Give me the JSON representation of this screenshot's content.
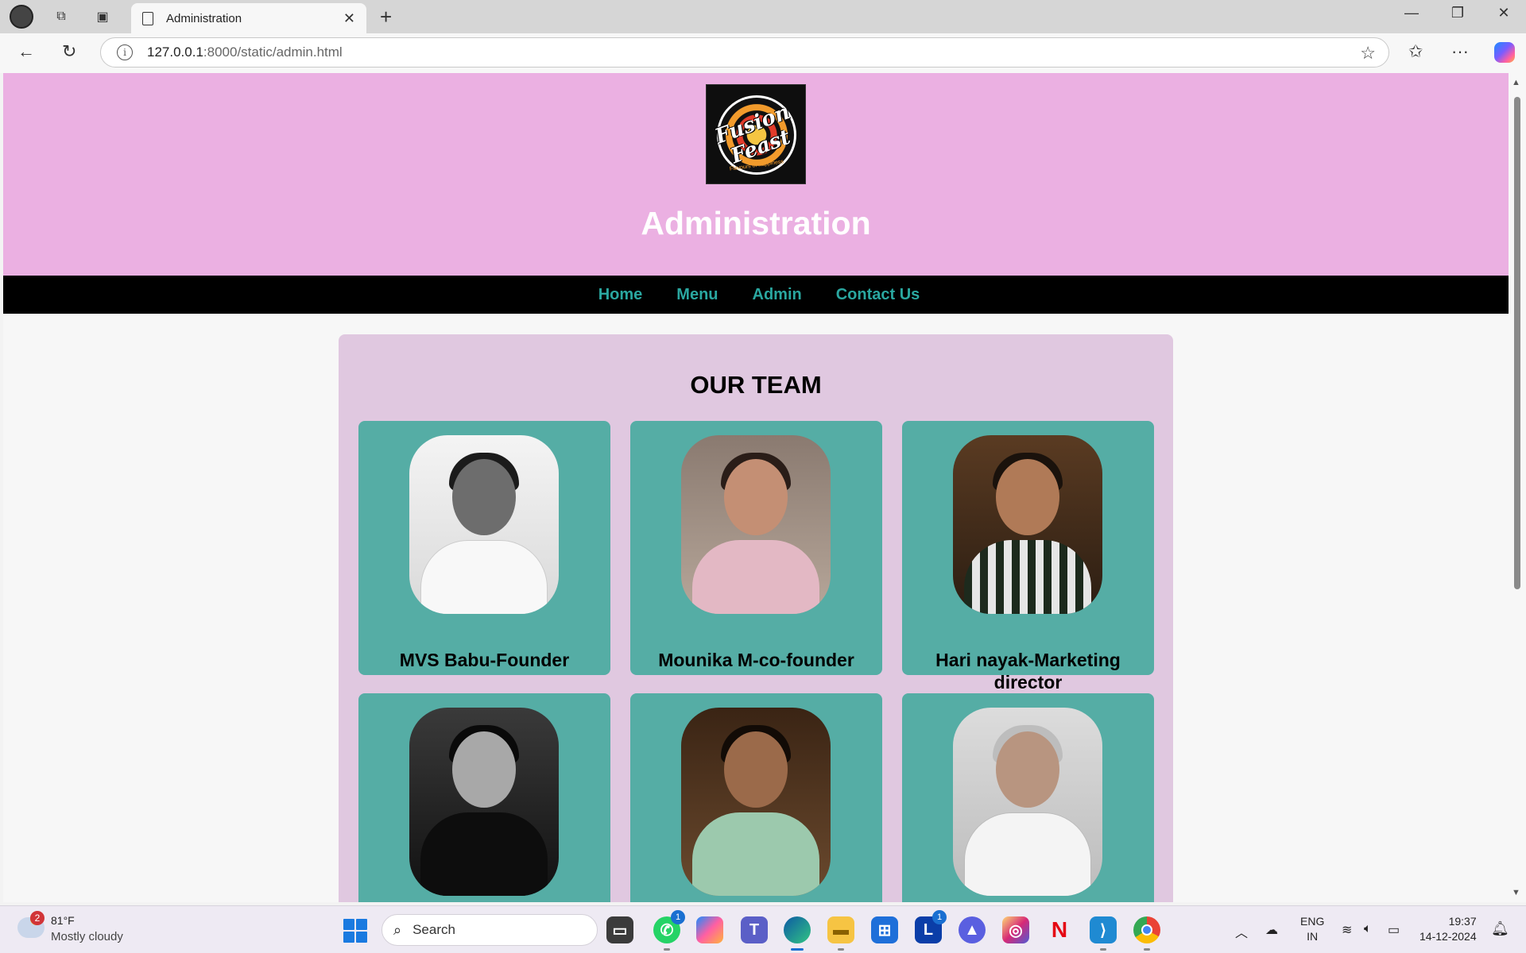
{
  "browser": {
    "tab_title": "Administration",
    "url_host": "127.0.0.1",
    "url_path": ":8000/static/admin.html"
  },
  "site": {
    "logo_text": "Fusion Feast",
    "logo_tagline": "Flavours of happiness",
    "title": "Administration",
    "nav": [
      "Home",
      "Menu",
      "Admin",
      "Contact Us"
    ],
    "nav_color": "#2aa7a0",
    "header_color": "#ebb0e2"
  },
  "team": {
    "heading": "OUR TEAM",
    "section_color": "#e0c8e0",
    "card_color": "#55ada5",
    "members": [
      {
        "name": "MVS Babu-Founder",
        "photo": "portrait-bw-man"
      },
      {
        "name": "Mounika M-co-founder",
        "photo": "portrait-woman"
      },
      {
        "name": "Hari nayak-Marketing director",
        "photo": "portrait-man-checked-shirt"
      },
      {
        "name": "",
        "photo": "portrait-man-black-shirt"
      },
      {
        "name": "",
        "photo": "portrait-chef-green-jacket"
      },
      {
        "name": "",
        "photo": "portrait-chef-white-coat"
      }
    ]
  },
  "taskbar": {
    "weather_badge": "2",
    "weather_temp": "81°F",
    "weather_desc": "Mostly cloudy",
    "search_label": "Search",
    "whatsapp_badge": "1",
    "linkedin_badge": "1",
    "lang_line1": "ENG",
    "lang_line2": "IN",
    "time": "19:37",
    "date": "14-12-2024"
  }
}
